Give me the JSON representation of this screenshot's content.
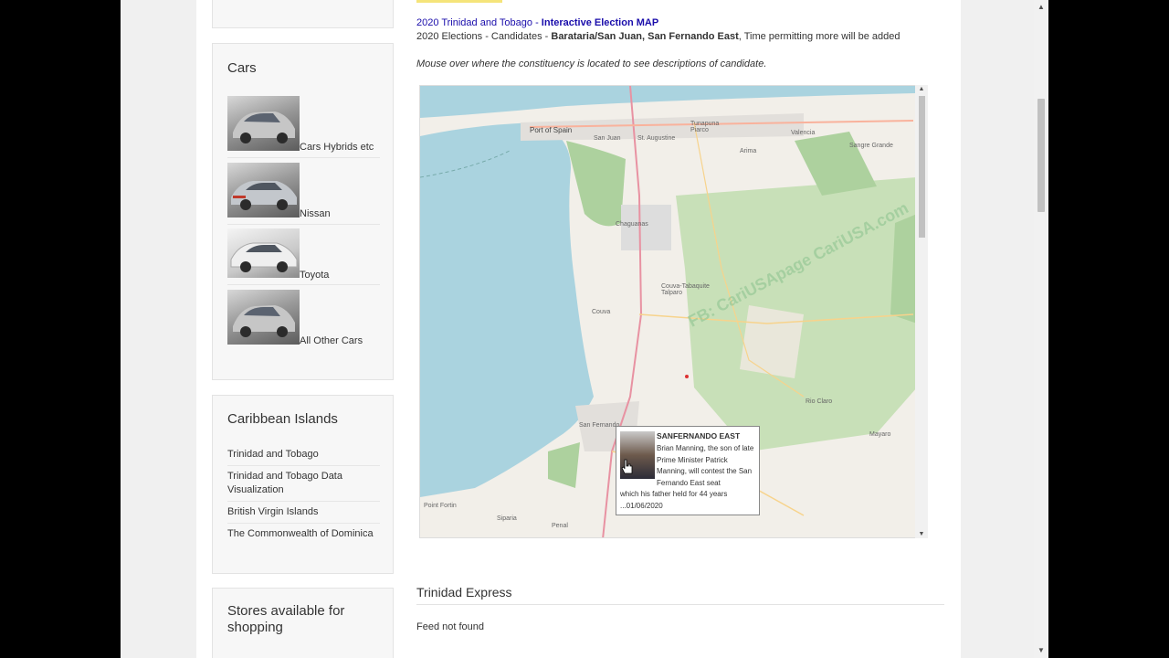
{
  "sidebar": {
    "cars": {
      "title": "Cars",
      "items": [
        {
          "label": "Cars Hybrids etc"
        },
        {
          "label": "Nissan"
        },
        {
          "label": "Toyota"
        },
        {
          "label": "All Other Cars"
        }
      ]
    },
    "islands": {
      "title": "Caribbean Islands",
      "items": [
        {
          "label": "Trinidad and Tobago"
        },
        {
          "label": "Trinidad and Tobago Data Visualization"
        },
        {
          "label": "British Virgin Islands"
        },
        {
          "label": "The Commonwealth of Dominica"
        }
      ]
    },
    "stores": {
      "title": "Stores available for shopping"
    }
  },
  "main": {
    "heading_prefix": "2020 Trinidad and Tobago - ",
    "heading_link": "Interactive Election MAP",
    "subline_prefix": "2020 Elections - Candidates - ",
    "subline_bold": "Barataria/San Juan, San Fernando East",
    "subline_suffix": ", Time permitting more will be added",
    "instruction": "Mouse over where the constituency is located to see descriptions of candidate.",
    "map": {
      "watermark": "FB: CariUSApage CariUSA.com",
      "labels": {
        "port_of_spain": "Port of Spain",
        "san_juan": "San Juan",
        "st_augustine": "St. Augustine",
        "tunapuna": "Tunapuna Piarco",
        "valencia": "Valencia",
        "sangre_grande": "Sangre Grande",
        "arima": "Arima",
        "chaguanas": "Chaguanas",
        "couva_tabaquite": "Couva-Tabaquite Talparo",
        "couva": "Couva",
        "rio_claro": "Rio Claro",
        "san_fernando": "San Fernando",
        "point_fortin": "Point Fortin",
        "siparia": "Siparia",
        "penal": "Penal",
        "mayaro": "Mayaro"
      }
    },
    "tooltip": {
      "title": "SANFERNANDO EAST",
      "body": "Brian Manning, the son of late Prime Minister Patrick Manning, will contest the San Fernando East seat",
      "body2": "which his father held for 44 years ...01/06/2020"
    },
    "express": {
      "title": "Trinidad Express",
      "feed": "Feed not found"
    }
  },
  "colors": {
    "link_blue": "#1a0dab",
    "water": "#aad3df",
    "forest": "#add19e",
    "land": "#f2efe9"
  }
}
